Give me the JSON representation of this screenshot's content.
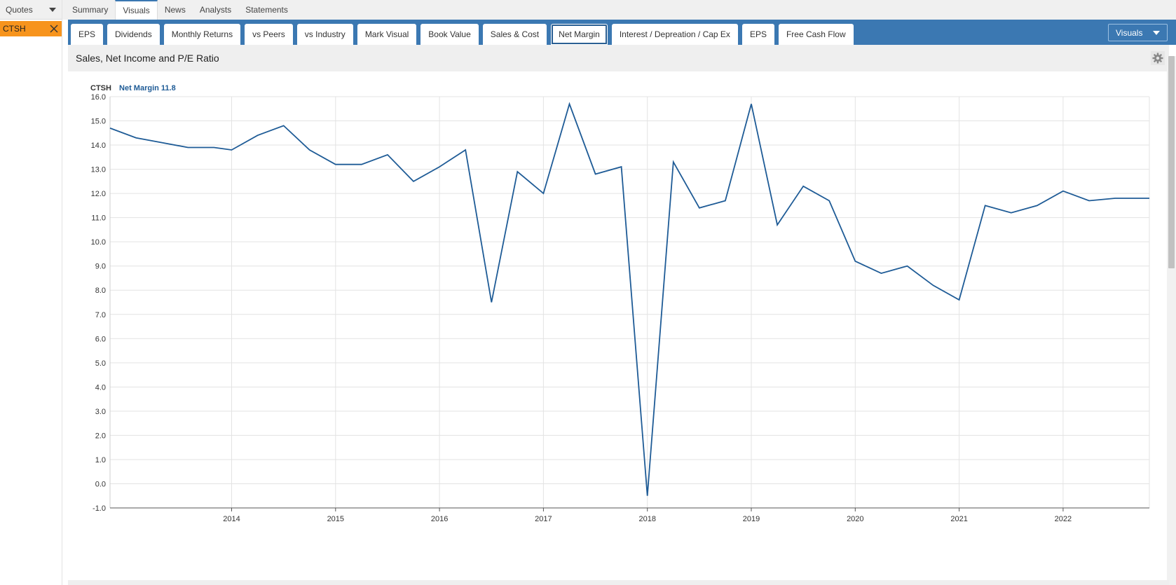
{
  "sidebar": {
    "quotes_label": "Quotes",
    "tickers": [
      {
        "symbol": "CTSH"
      }
    ]
  },
  "top_tabs": [
    {
      "label": "Summary",
      "active": false
    },
    {
      "label": "Visuals",
      "active": true
    },
    {
      "label": "News",
      "active": false
    },
    {
      "label": "Analysts",
      "active": false
    },
    {
      "label": "Statements",
      "active": false
    }
  ],
  "sub_tabs": [
    {
      "label": "EPS",
      "active": false
    },
    {
      "label": "Dividends",
      "active": false
    },
    {
      "label": "Monthly Returns",
      "active": false
    },
    {
      "label": "vs Peers",
      "active": false
    },
    {
      "label": "vs Industry",
      "active": false
    },
    {
      "label": "Mark Visual",
      "active": false
    },
    {
      "label": "Book Value",
      "active": false
    },
    {
      "label": "Sales & Cost",
      "active": false
    },
    {
      "label": "Net Margin",
      "active": true
    },
    {
      "label": "Interest / Depreation / Cap Ex",
      "active": false
    },
    {
      "label": "EPS",
      "active": false
    },
    {
      "label": "Free Cash Flow",
      "active": false
    }
  ],
  "visuals_dropdown": "Visuals",
  "panel": {
    "title": "Sales, Net Income and P/E Ratio"
  },
  "legend": {
    "symbol": "CTSH",
    "metric": "Net Margin 11.8"
  },
  "colors": {
    "accent": "#3b78b2",
    "line": "#1e5b96",
    "ticker_highlight": "#f7941d"
  },
  "chart_data": {
    "type": "line",
    "x": [
      2012.83,
      2013.08,
      2013.33,
      2013.58,
      2013.83,
      2014.0,
      2014.25,
      2014.5,
      2014.75,
      2015.0,
      2015.25,
      2015.5,
      2015.75,
      2016.0,
      2016.25,
      2016.5,
      2016.75,
      2017.0,
      2017.25,
      2017.5,
      2017.75,
      2018.0,
      2018.25,
      2018.5,
      2018.75,
      2019.0,
      2019.25,
      2019.5,
      2019.75,
      2020.0,
      2020.25,
      2020.5,
      2020.75,
      2021.0,
      2021.25,
      2021.5,
      2021.75,
      2022.0,
      2022.25,
      2022.5,
      2022.83
    ],
    "series": [
      {
        "name": "Net Margin",
        "values": [
          14.7,
          14.3,
          14.1,
          13.9,
          13.9,
          13.8,
          14.4,
          14.8,
          13.8,
          13.2,
          13.2,
          13.6,
          12.5,
          13.1,
          13.8,
          7.5,
          12.9,
          12.0,
          15.7,
          12.8,
          13.1,
          -0.5,
          13.3,
          11.4,
          11.7,
          15.7,
          10.7,
          12.3,
          11.7,
          9.2,
          8.7,
          9.0,
          8.2,
          7.6,
          11.5,
          11.2,
          11.5,
          12.1,
          11.7,
          11.8,
          11.8
        ]
      }
    ],
    "xticks": [
      "2014",
      "2015",
      "2016",
      "2017",
      "2018",
      "2019",
      "2020",
      "2021",
      "2022"
    ],
    "yticks": [
      "16.0",
      "15.0",
      "14.0",
      "13.0",
      "12.0",
      "11.0",
      "10.0",
      "9.0",
      "8.0",
      "7.0",
      "6.0",
      "5.0",
      "4.0",
      "3.0",
      "2.0",
      "1.0",
      "0.0",
      "-1.0"
    ],
    "xlim": [
      2012.83,
      2022.83
    ],
    "ylim": [
      -1.0,
      16.0
    ],
    "grid": true
  }
}
